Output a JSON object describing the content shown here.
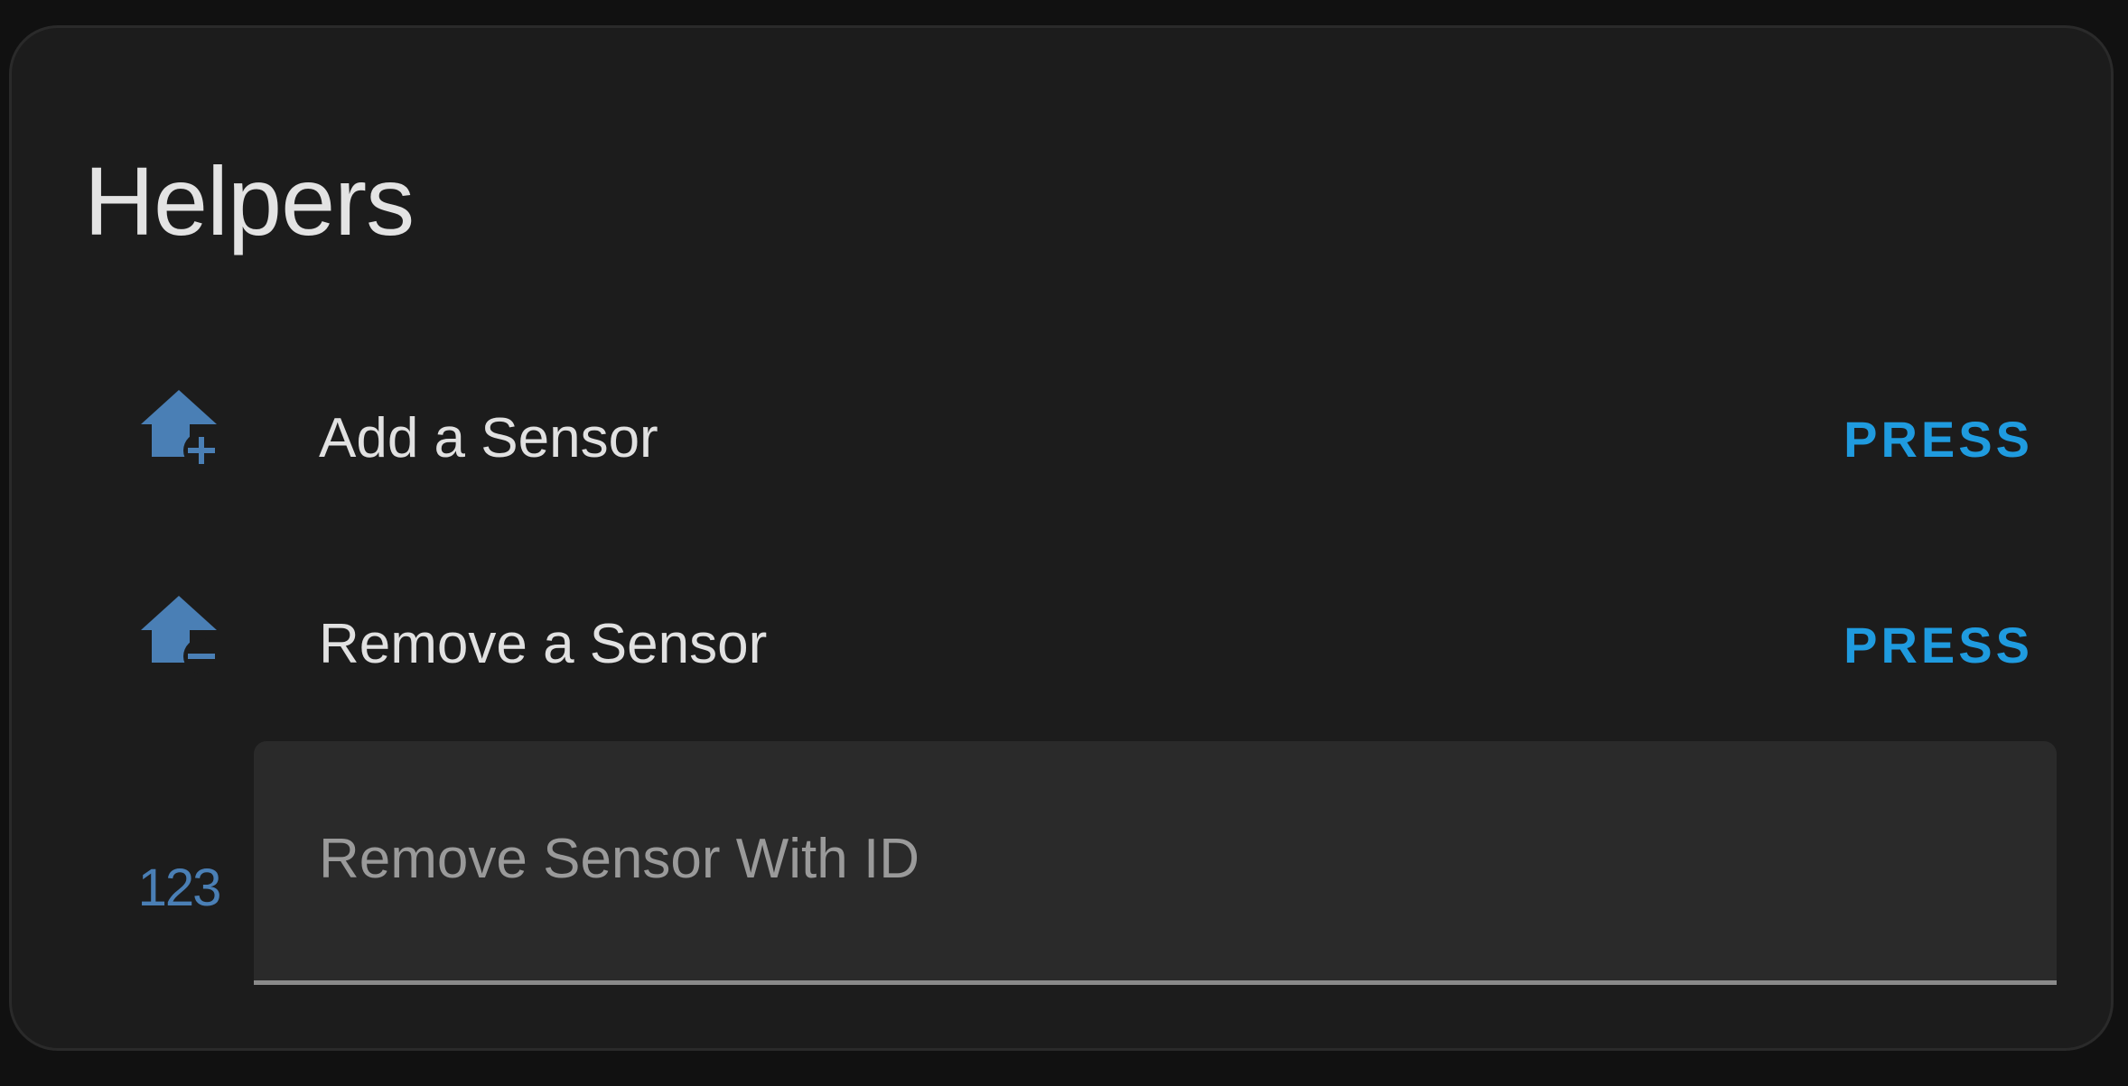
{
  "card": {
    "title": "Helpers"
  },
  "rows": [
    {
      "icon": "home-plus-icon",
      "label": "Add a Sensor",
      "action": "PRESS"
    },
    {
      "icon": "home-minus-icon",
      "label": "Remove a Sensor",
      "action": "PRESS"
    }
  ],
  "number_input": {
    "icon": "numeric-icon",
    "icon_text": "123",
    "label": "Remove Sensor With ID",
    "value": ""
  },
  "colors": {
    "accent": "#1f9bdf",
    "icon": "#4a7fb5",
    "card_background": "#1c1c1c"
  }
}
